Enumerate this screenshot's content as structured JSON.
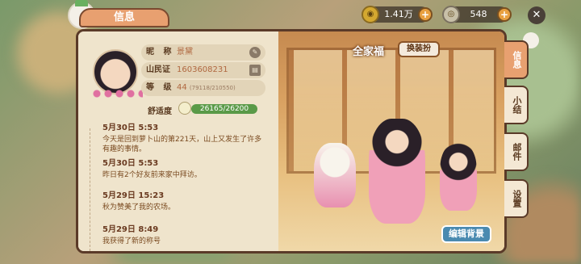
{
  "header": {
    "title": "信息",
    "gold": "1.41万",
    "silver": "548"
  },
  "profile": {
    "nickname_label": "昵 称",
    "nickname": "景黛",
    "id_label": "山民证",
    "id": "1603608231",
    "level_label": "等 级",
    "level": "44",
    "level_exp": "(79118/210550)",
    "comfort_label": "舒适度",
    "comfort_value": "26165/26200"
  },
  "diary": [
    {
      "date": "5月30日 5:53",
      "text": "今天是回到萝卜山的第221天，山上又发生了许多有趣的事情。"
    },
    {
      "date": "5月30日 5:53",
      "text": "昨日有2个好友前来家中拜访。"
    },
    {
      "date": "5月29日 15:23",
      "text": "秋为赞美了我的农场。"
    },
    {
      "date": "5月29日 8:49",
      "text": "我获得了新的称号"
    }
  ],
  "scene": {
    "title": "全家福",
    "change_btn": "换装扮",
    "edit_btn": "编辑背景"
  },
  "tabs": [
    "信息",
    "小结",
    "邮件",
    "设置"
  ]
}
